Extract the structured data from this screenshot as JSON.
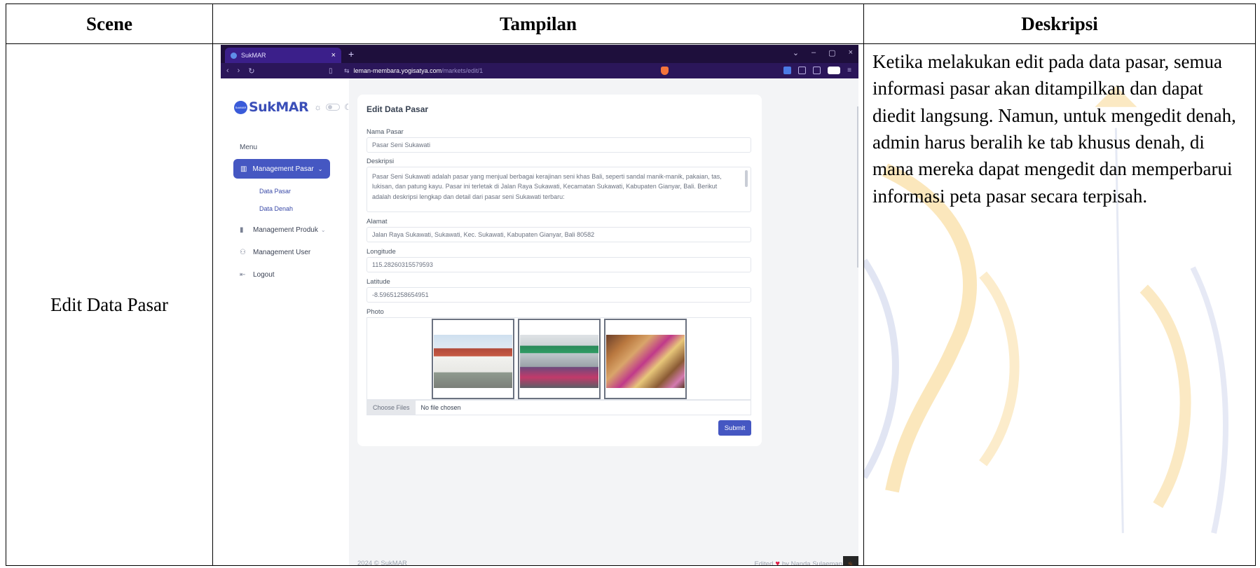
{
  "table": {
    "headers": [
      "Scene",
      "Tampilan",
      "Deskripsi"
    ],
    "scene": "Edit Data Pasar",
    "description": "Ketika melakukan edit pada data pasar, semua informasi pasar akan ditampilkan dan dapat diedit langsung. Namun, untuk mengedit denah, admin harus beralih ke tab khusus denah, di mana mereka dapat mengedit dan memperbarui informasi peta pasar secara terpisah."
  },
  "browser": {
    "tab_title": "SukMAR",
    "url_host": "leman-membara.yogisatya.com",
    "url_path": "/markets/edit/1"
  },
  "app": {
    "logo_text": "SukMAR",
    "logo_mark_text": "SukMAR",
    "menu_label": "Menu",
    "menu_active": "Management Pasar",
    "submenu": [
      "Data Pasar",
      "Data Denah"
    ],
    "menu_items": [
      "Management Produk",
      "Management User",
      "Logout"
    ]
  },
  "form": {
    "title": "Edit Data Pasar",
    "nama_label": "Nama Pasar",
    "nama_value": "Pasar Seni Sukawati",
    "deskripsi_label": "Deskripsi",
    "deskripsi_value": "Pasar Seni Sukawati adalah pasar yang menjual berbagai kerajinan seni khas Bali, seperti sandal manik-manik, pakaian, tas, lukisan, dan patung kayu. Pasar ini terletak di Jalan Raya Sukawati, Kecamatan Sukawati, Kabupaten Gianyar, Bali. Berikut adalah deskripsi lengkap dan detail dari pasar seni Sukawati terbaru:",
    "alamat_label": "Alamat",
    "alamat_value": "Jalan Raya Sukawati, Sukawati, Kec. Sukawati, Kabupaten Gianyar, Bali 80582",
    "longitude_label": "Longitude",
    "longitude_value": "115.28260315579593",
    "latitude_label": "Latitude",
    "latitude_value": "-8.59651258654951",
    "photo_label": "Photo",
    "choose_files": "Choose Files",
    "no_file": "No file chosen",
    "submit": "Submit"
  },
  "footer": {
    "copyright": "2024 © SukMAR",
    "edited": "Edited",
    "by": "by Nanda Sulaeman"
  },
  "colors": {
    "primary": "#4557c2",
    "tabbar": "#1e0f3c",
    "addressbar": "#2b165a",
    "watermark": "#f4b942"
  }
}
